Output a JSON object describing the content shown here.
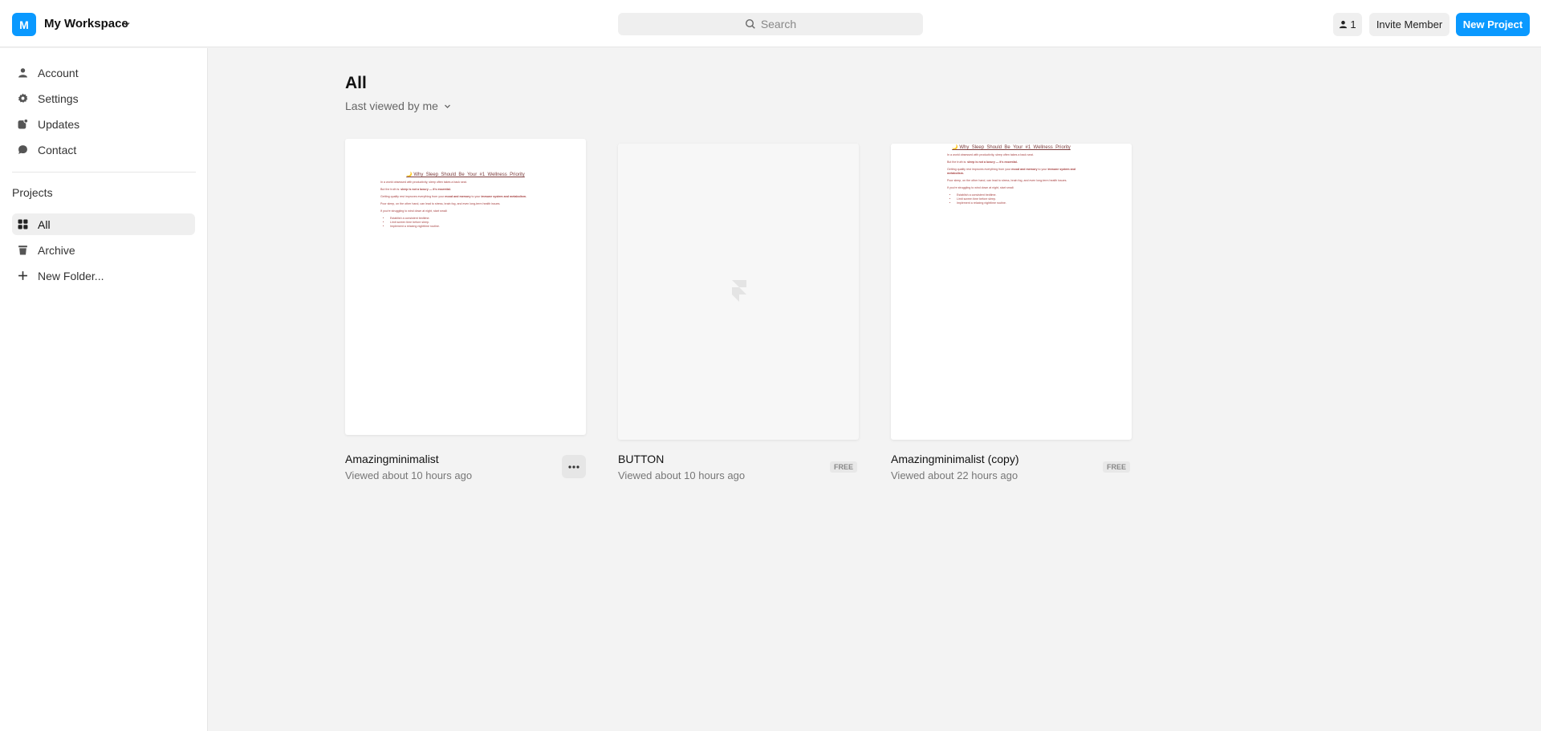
{
  "workspace": {
    "avatar": "M",
    "name": "My Workspace"
  },
  "search": {
    "placeholder": "Search"
  },
  "header": {
    "member_count": "1",
    "invite_label": "Invite Member",
    "new_project_label": "New Project"
  },
  "colors": {
    "accent": "#0a99ff"
  },
  "sidebar": {
    "items": [
      {
        "label": "Account",
        "icon": "user-icon"
      },
      {
        "label": "Settings",
        "icon": "gear-icon"
      },
      {
        "label": "Updates",
        "icon": "updates-icon"
      },
      {
        "label": "Contact",
        "icon": "chat-icon"
      }
    ],
    "projects_title": "Projects",
    "projects": [
      {
        "label": "All",
        "icon": "grid-icon",
        "active": true
      },
      {
        "label": "Archive",
        "icon": "trash-icon"
      },
      {
        "label": "New Folder...",
        "icon": "plus-icon"
      }
    ]
  },
  "main": {
    "title": "All",
    "sort_label": "Last viewed by me",
    "projects": [
      {
        "name": "Amazingminimalist",
        "viewed": "Viewed about 10 hours ago",
        "badge": ""
      },
      {
        "name": "BUTTON",
        "viewed": "Viewed about 10 hours ago",
        "badge": "FREE"
      },
      {
        "name": "Amazingminimalist (copy)",
        "viewed": "Viewed about 22 hours ago",
        "badge": "FREE"
      }
    ]
  }
}
